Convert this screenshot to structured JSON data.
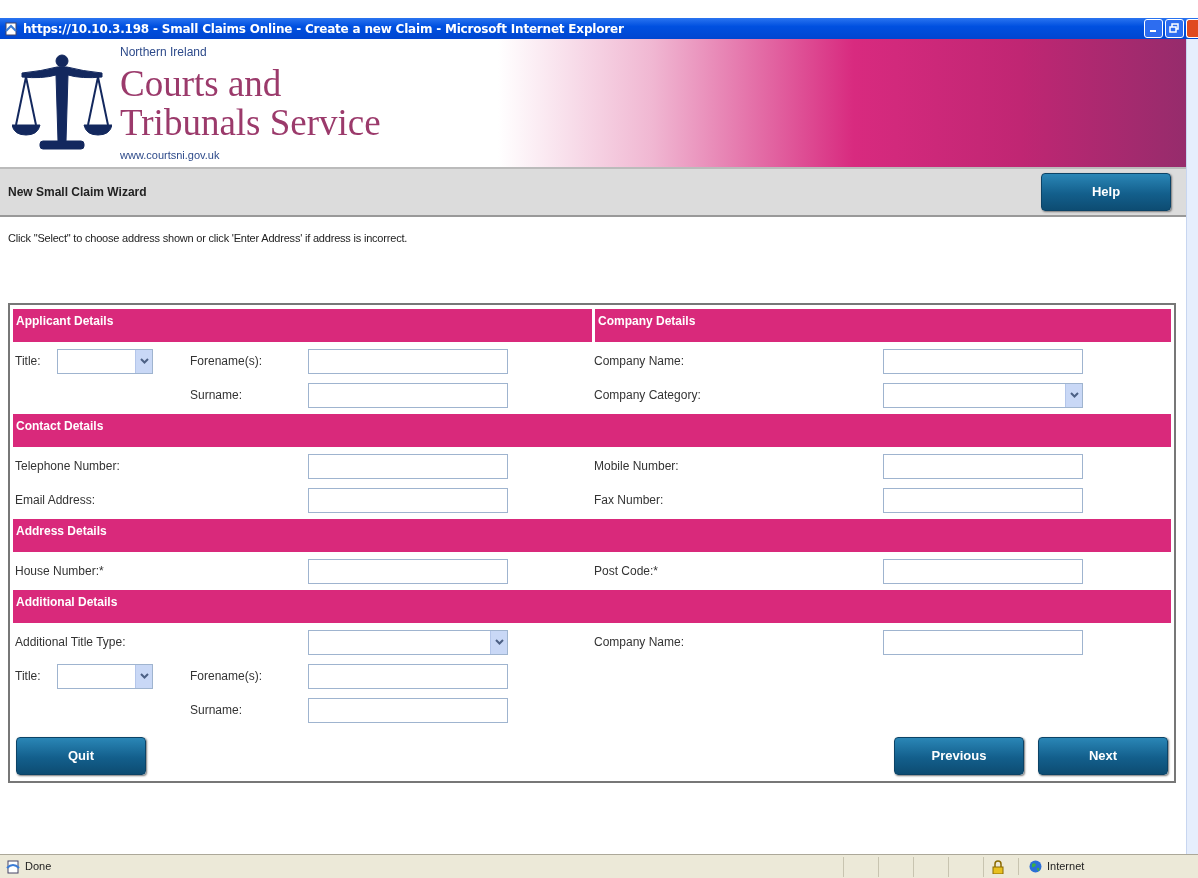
{
  "window": {
    "title": "https://10.10.3.198 - Small Claims Online - Create a new Claim - Microsoft Internet Explorer"
  },
  "header": {
    "region": "Northern Ireland",
    "name_line_1": "Courts and",
    "name_line_2": "Tribunals Service",
    "website": "www.courtsni.gov.uk"
  },
  "toolbar": {
    "title": "New Small Claim Wizard",
    "help_button": "Help"
  },
  "instruction": "Click \"Select\" to choose address shown or click 'Enter Address' if address is incorrect.",
  "sections": [
    {
      "headings": [
        "Applicant Details",
        "Company Details"
      ],
      "rows": [
        {
          "cells": [
            {
              "kind": "label",
              "text": "Title:"
            },
            {
              "kind": "small_select"
            },
            {
              "kind": "label",
              "text": "Forename(s):"
            },
            {
              "kind": "input"
            },
            {
              "kind": "label",
              "text": "Company Name:"
            },
            {
              "kind": "input"
            }
          ]
        },
        {
          "cells": [
            {
              "kind": "blank"
            },
            {
              "kind": "blank"
            },
            {
              "kind": "label",
              "text": "Surname:"
            },
            {
              "kind": "input"
            },
            {
              "kind": "label",
              "text": "Company Category:"
            },
            {
              "kind": "wide_select"
            }
          ]
        }
      ]
    },
    {
      "headings": [
        "Contact Details"
      ],
      "rows": [
        {
          "cells": [
            {
              "kind": "label",
              "text": "Telephone Number:"
            },
            {
              "kind": "blank"
            },
            {
              "kind": "blank"
            },
            {
              "kind": "input"
            },
            {
              "kind": "label",
              "text": "Mobile Number:"
            },
            {
              "kind": "input"
            }
          ]
        },
        {
          "cells": [
            {
              "kind": "label",
              "text": "Email Address:"
            },
            {
              "kind": "blank"
            },
            {
              "kind": "blank"
            },
            {
              "kind": "input"
            },
            {
              "kind": "label",
              "text": "Fax Number:"
            },
            {
              "kind": "input"
            }
          ]
        }
      ]
    },
    {
      "headings": [
        "Address Details"
      ],
      "rows": [
        {
          "cells": [
            {
              "kind": "label",
              "text": "House Number:*"
            },
            {
              "kind": "blank"
            },
            {
              "kind": "blank"
            },
            {
              "kind": "input"
            },
            {
              "kind": "label",
              "text": "Post Code:*"
            },
            {
              "kind": "input"
            }
          ]
        }
      ]
    },
    {
      "headings": [
        "Additional Details"
      ],
      "rows": [
        {
          "cells": [
            {
              "kind": "label",
              "text": "Additional Title Type:"
            },
            {
              "kind": "blank"
            },
            {
              "kind": "blank"
            },
            {
              "kind": "wide_select"
            },
            {
              "kind": "label",
              "text": "Company Name:"
            },
            {
              "kind": "input"
            }
          ]
        },
        {
          "cells": [
            {
              "kind": "label",
              "text": "Title:"
            },
            {
              "kind": "small_select"
            },
            {
              "kind": "label",
              "text": "Forename(s):"
            },
            {
              "kind": "input"
            },
            {
              "kind": "blank"
            },
            {
              "kind": "blank"
            }
          ]
        },
        {
          "cells": [
            {
              "kind": "blank"
            },
            {
              "kind": "blank"
            },
            {
              "kind": "label",
              "text": "Surname:"
            },
            {
              "kind": "input"
            },
            {
              "kind": "blank"
            },
            {
              "kind": "blank"
            }
          ]
        }
      ]
    }
  ],
  "actions": {
    "left": [
      "Quit"
    ],
    "right": [
      "Previous",
      "Next"
    ]
  },
  "status_bar": {
    "text": "Done",
    "zone": "Internet"
  }
}
